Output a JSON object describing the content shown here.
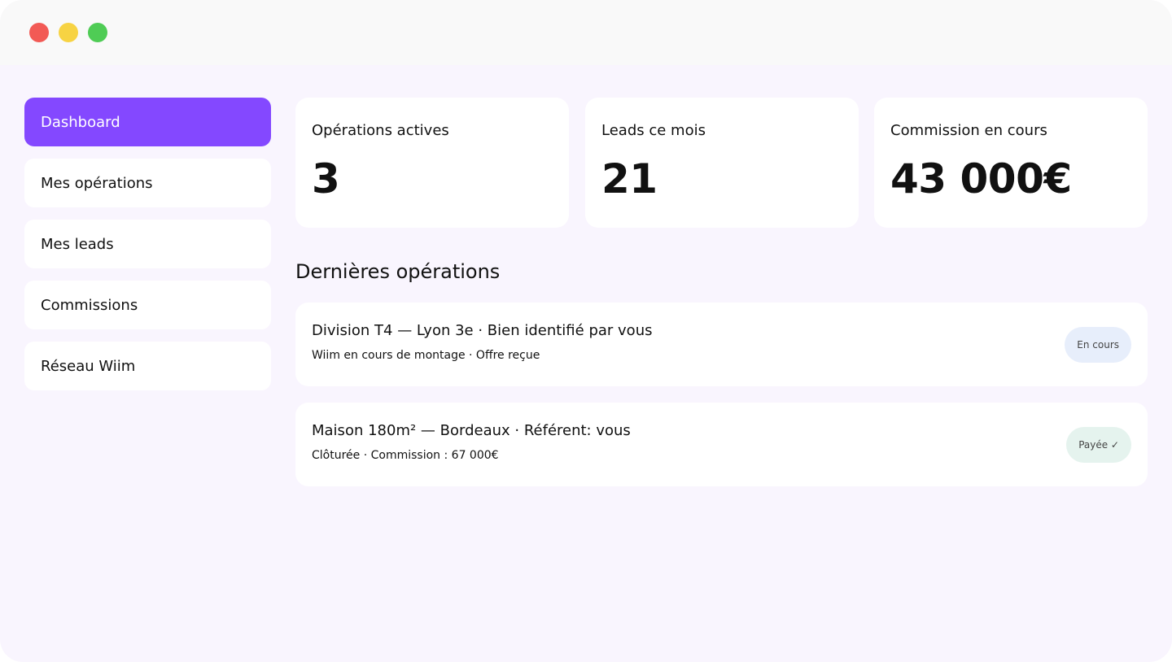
{
  "window": {
    "controls": [
      {
        "name": "close",
        "color": "#f25a55"
      },
      {
        "name": "minimize",
        "color": "#f7d343"
      },
      {
        "name": "maximize",
        "color": "#4fcc55"
      }
    ]
  },
  "colors": {
    "accent": "#8448ff",
    "background": "#f9f5fe",
    "badge_in_progress": "#e7eefb",
    "badge_paid": "#e5f3ee"
  },
  "sidebar": {
    "items": [
      {
        "label": "Dashboard",
        "active": true
      },
      {
        "label": "Mes opérations",
        "active": false
      },
      {
        "label": "Mes leads",
        "active": false
      },
      {
        "label": "Commissions",
        "active": false
      },
      {
        "label": "Réseau Wiim",
        "active": false
      }
    ]
  },
  "stats": [
    {
      "label": "Opérations actives",
      "value": "3"
    },
    {
      "label": "Leads ce mois",
      "value": "21"
    },
    {
      "label": "Commission en cours",
      "value": "43 000€"
    }
  ],
  "recent": {
    "title": "Dernières opérations",
    "operations": [
      {
        "title": "Division T4 — Lyon 3e · Bien identifié par vous",
        "subtitle": "Wiim en cours de montage · Offre reçue",
        "status": "En cours"
      },
      {
        "title": "Maison 180m² — Bordeaux · Référent: vous",
        "subtitle": "Clôturée · Commission : 67 000€",
        "status": "Payée ✓"
      }
    ]
  }
}
